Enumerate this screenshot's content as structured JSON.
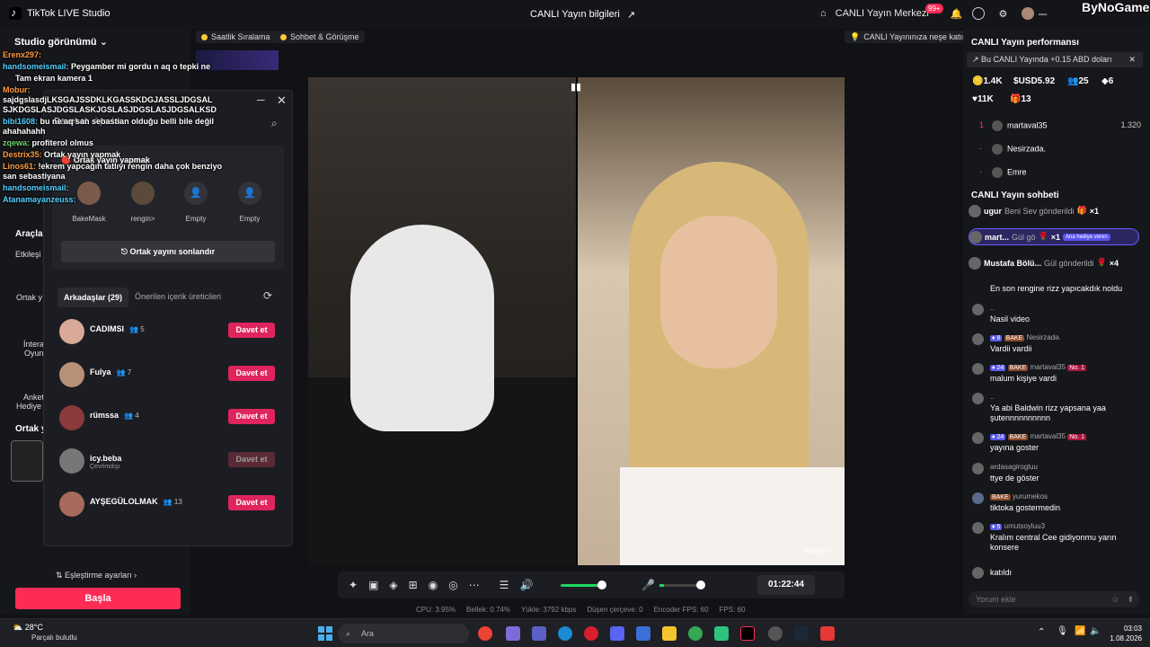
{
  "titlebar": {
    "app_name": "TikTok LIVE Studio",
    "center_title": "CANLI Yayın bilgileri",
    "live_center": "CANLI Yayın Merkezi",
    "notif_badge": "99+",
    "watermark": "ByNoGame"
  },
  "tags": {
    "hourly_rank": "Saatlik Sıralama",
    "chat_call": "Sohbet & Görüşme",
    "fun_tip": "CANLI Yayınınıza neşe katın"
  },
  "left": {
    "studio_view": "Studio görünümü",
    "tools": "Araçla",
    "etk": "Etkileşi",
    "ortak_y": "Ortak y",
    "intera": "İntera",
    "oyun": "Oyun",
    "anket": "Anket",
    "hediye": "Hediye",
    "ortak_section": "Ortak y",
    "match_settings": "Eşleştirme ayarları",
    "start": "Başla"
  },
  "overlay_chat": [
    {
      "user": "Erenx297:",
      "text": ""
    },
    {
      "user": "handsomeismail:",
      "text": "Peygamber mi gordu n aq o tepki ne"
    },
    {
      "user": "Tam ekran kamera 1",
      "text": ""
    },
    {
      "user": "Mobur:",
      "text": "sajdgslasdjLKSGAJSSDKLKGASSKDGJASSLJDGSAL SJKDGSLASJDGSLASKJGSLASJDGSLASJDGSALKSD"
    },
    {
      "user": "bibi1608:",
      "text": "bu ne aq san sebastian olduğu belli bile değil ahahahahh"
    },
    {
      "user": "zqewa:",
      "text": "profiterol olmus"
    },
    {
      "user": "Destrix35:",
      "text": "Ortak yayın yapmak"
    },
    {
      "user": "Linos61:",
      "text": "!ekrem yapcağın tatlıyı rengin daha çok benziyo san sebastiyana"
    },
    {
      "user": "handsomeismail:",
      "text": ""
    },
    {
      "user": "Atanamayanzeuss:",
      "text": ""
    }
  ],
  "popup": {
    "tab_invite": "Davet et",
    "tab_settings": "Ayarlar",
    "cohost_title": "Ortak yayın yapmak",
    "slots": [
      "BakeMask",
      "rengin>",
      "Empty",
      "Empty"
    ],
    "end_cohost": "Ortak yayını sonlandır",
    "friends_tab": "Arkadaşlar (29)",
    "suggested_tab": "Önerilen içerik üreticileri",
    "invite_label": "Davet et",
    "friends": [
      {
        "name": "CADIMSI",
        "count": "5",
        "sub": "",
        "disabled": false
      },
      {
        "name": "Fulya",
        "count": "7",
        "sub": "",
        "disabled": false
      },
      {
        "name": "rümssa",
        "count": "4",
        "sub": "",
        "disabled": false
      },
      {
        "name": "icy.beba",
        "count": "",
        "sub": "Çevrimdışı",
        "disabled": true
      },
      {
        "name": "AYŞEGÜLOLMAK",
        "count": "13",
        "sub": "",
        "disabled": false
      }
    ]
  },
  "video": {
    "guest_label": "rengin>"
  },
  "controls": {
    "timer": "01:22:44",
    "volume_level": 0.65,
    "mic_level": 0.1
  },
  "stats": {
    "cpu": "CPU: 3.95%",
    "memory": "Bellek: 0.74%",
    "upload": "Yükle: 3792 kbps",
    "dropped": "Düşen çerçeve: 0",
    "encoder_fps": "Encoder FPS: 60",
    "fps": "FPS: 60"
  },
  "right": {
    "perf_title": "CANLI Yayın performansı",
    "perf_banner": "Bu CANLI Yayında +0.15 ABD doları",
    "coins": "1.4K",
    "usd": "USD5.92",
    "viewers": "25",
    "hosts": "6",
    "likes": "11K",
    "gifters": "13",
    "ranking": [
      {
        "rank": "1",
        "name": "martaval35",
        "value": "1.320"
      },
      {
        "rank": "",
        "name": "Nesirzada.",
        "value": ""
      },
      {
        "rank": "",
        "name": "Emre",
        "value": ""
      }
    ],
    "chat_title": "CANLI Yayın sohbeti",
    "gifts": [
      {
        "user": "ugur",
        "text": "Beni Sev gönderildi",
        "mult": "×1"
      },
      {
        "user": "mart...",
        "text": "Gül gö",
        "mult": "×1",
        "tag": "Ana hediye veren"
      },
      {
        "user": "Mustafa Bölü...",
        "text": "Gül gönderildi",
        "mult": "×4"
      }
    ],
    "messages": [
      {
        "user": "",
        "text": "En son rengine rizz yapıcakdık noldu"
      },
      {
        "user": "..",
        "text": "Nasil video"
      },
      {
        "user": "Nesirzadə.",
        "text": "Vardii vardii",
        "lvl": "8"
      },
      {
        "user": "martaval35",
        "text": "malum kişiye vardi",
        "lvl": "24"
      },
      {
        "user": "..",
        "text": "Ya abi Baldwin rizz yapsana yaa şutennnnnnnnnn"
      },
      {
        "user": "martaval35",
        "text": "yayına goster",
        "lvl": "24"
      },
      {
        "user": "ardasagirogluu",
        "text": "ttye de göster"
      },
      {
        "user": "yurumekos",
        "text": "tiktoka gostermedin"
      },
      {
        "user": "umutsoyluu3",
        "text": "Kralım central Cee gidiyonmu yarın konsere",
        "lvl": "5"
      },
      {
        "user": "",
        "text": "katıldı"
      }
    ],
    "badge_bake": "BAKE",
    "badge_no1": "No. 1",
    "comment_placeholder": "Yorum ekle"
  },
  "taskbar": {
    "temp": "28°C",
    "weather": "Parçalı bulutlu",
    "search": "Ara",
    "time": "03:03",
    "date": "1.08.2026"
  }
}
